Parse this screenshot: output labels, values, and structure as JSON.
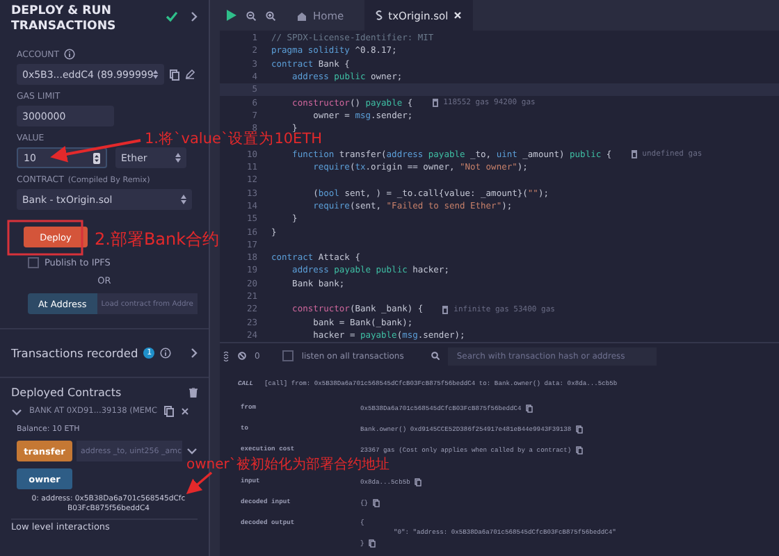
{
  "panel": {
    "title": "DEPLOY & RUN TRANSACTIONS",
    "account": {
      "label": "ACCOUNT",
      "value": "0x5B3...eddC4 (89.999999"
    },
    "gas_limit": {
      "label": "GAS LIMIT",
      "value": "3000000"
    },
    "value": {
      "label": "VALUE",
      "amount": "10",
      "unit": "Ether"
    },
    "contract": {
      "label": "CONTRACT",
      "note": "(Compiled By Remix)",
      "value": "Bank - txOrigin.sol"
    },
    "deploy_button": "Deploy",
    "publish": {
      "label": "Publish to IPFS",
      "checked": false
    },
    "or_label": "OR",
    "at_address_button": "At Address",
    "load_contract_placeholder": "Load contract from Addre",
    "transactions_recorded": {
      "label": "Transactions recorded",
      "count": "1"
    },
    "deployed": {
      "title": "Deployed Contracts",
      "instance": {
        "label": "BANK AT 0XD91...39138 (MEMC",
        "expanded": true,
        "balance": "Balance: 10 ETH",
        "functions": [
          {
            "label": "transfer",
            "kind": "transact",
            "placeholder": "address _to, uint256 _amc"
          },
          {
            "label": "owner",
            "kind": "call"
          }
        ],
        "result": "0: address: 0x5B38Da6a701c568545dCfcB03FcB875f56beddC4"
      },
      "low_level": "Low level interactions"
    }
  },
  "editor": {
    "tabs": [
      {
        "label": "Home",
        "selected": false
      },
      {
        "label": "txOrigin.sol",
        "selected": true
      }
    ],
    "lines": [
      {
        "number": "1",
        "segments": [
          {
            "kind": "comment",
            "text": "// SPDX-License-Identifier: MIT"
          }
        ]
      },
      {
        "number": "2",
        "segments": [
          {
            "kind": "keyword",
            "text": "pragma solidity"
          },
          {
            "kind": "plain",
            "text": " ^0.8.17;"
          }
        ]
      },
      {
        "number": "3",
        "segments": [
          {
            "kind": "keyword",
            "text": "contract"
          },
          {
            "kind": "plain",
            "text": " Bank {"
          }
        ]
      },
      {
        "number": "4",
        "segments": [
          {
            "kind": "keyword",
            "text": "    address"
          },
          {
            "kind": "modifier",
            "text": " public"
          },
          {
            "kind": "plain",
            "text": " owner;"
          }
        ]
      },
      {
        "number": "5",
        "active": true
      },
      {
        "number": "6",
        "segments": [
          {
            "kind": "special",
            "text": "    constructor"
          },
          {
            "kind": "plain",
            "text": "() "
          },
          {
            "kind": "modifier",
            "text": "payable"
          },
          {
            "kind": "plain",
            "text": " {"
          }
        ],
        "hint": "118552 gas 94200 gas"
      },
      {
        "number": "7",
        "segments": [
          {
            "kind": "plain",
            "text": "        owner = "
          },
          {
            "kind": "keyword",
            "text": "msg"
          },
          {
            "kind": "plain",
            "text": ".sender;"
          }
        ]
      },
      {
        "number": "8",
        "segments": [
          {
            "kind": "plain",
            "text": "    }"
          }
        ]
      },
      {
        "active": false
      },
      {
        "number": "10",
        "segments": [
          {
            "kind": "keyword",
            "text": "    function"
          },
          {
            "kind": "plain",
            "text": " transfer("
          },
          {
            "kind": "keyword",
            "text": "address"
          },
          {
            "kind": "modifier",
            "text": " payable"
          },
          {
            "kind": "plain",
            "text": " _to, "
          },
          {
            "kind": "keyword",
            "text": "uint"
          },
          {
            "kind": "plain",
            "text": " _amount) "
          },
          {
            "kind": "modifier",
            "text": "public"
          },
          {
            "kind": "plain",
            "text": " {"
          }
        ],
        "hint": "undefined gas"
      },
      {
        "number": "11",
        "segments": [
          {
            "kind": "keyword",
            "text": "        require"
          },
          {
            "kind": "plain",
            "text": "("
          },
          {
            "kind": "keyword",
            "text": "tx"
          },
          {
            "kind": "plain",
            "text": ".origin == owner, "
          },
          {
            "kind": "string",
            "text": "\"Not owner\""
          },
          {
            "kind": "plain",
            "text": ");"
          }
        ]
      },
      {
        "number": "12",
        "active": false
      },
      {
        "number": "13",
        "segments": [
          {
            "kind": "plain",
            "text": "        ("
          },
          {
            "kind": "keyword",
            "text": "bool"
          },
          {
            "kind": "plain",
            "text": " sent, ) = _to.call{value: _amount}("
          },
          {
            "kind": "string",
            "text": "\"\""
          },
          {
            "kind": "plain",
            "text": ");"
          }
        ]
      },
      {
        "number": "14",
        "segments": [
          {
            "kind": "keyword",
            "text": "        require"
          },
          {
            "kind": "plain",
            "text": "(sent, "
          },
          {
            "kind": "string",
            "text": "\"Failed to send Ether\""
          },
          {
            "kind": "plain",
            "text": ");"
          }
        ]
      },
      {
        "number": "15",
        "segments": [
          {
            "kind": "plain",
            "text": "    }"
          }
        ]
      },
      {
        "number": "16",
        "segments": [
          {
            "kind": "plain",
            "text": "}"
          }
        ]
      },
      {
        "number": "17",
        "active": false
      },
      {
        "number": "18",
        "segments": [
          {
            "kind": "keyword",
            "text": "contract"
          },
          {
            "kind": "plain",
            "text": " Attack {"
          }
        ]
      },
      {
        "number": "19",
        "segments": [
          {
            "kind": "keyword",
            "text": "    address"
          },
          {
            "kind": "modifier",
            "text": " payable public"
          },
          {
            "kind": "plain",
            "text": " hacker;"
          }
        ]
      },
      {
        "number": "20",
        "segments": [
          {
            "kind": "plain",
            "text": "    Bank bank;"
          }
        ]
      },
      {
        "number": "21",
        "active": false
      },
      {
        "number": "22",
        "segments": [
          {
            "kind": "special",
            "text": "    constructor"
          },
          {
            "kind": "plain",
            "text": "(Bank _bank) {"
          }
        ],
        "hint": "infinite gas 53400 gas"
      },
      {
        "number": "23",
        "segments": [
          {
            "kind": "plain",
            "text": "        bank = Bank(_bank);"
          }
        ]
      },
      {
        "number": "24",
        "segments": [
          {
            "kind": "plain",
            "text": "        hacker = "
          },
          {
            "kind": "modifier",
            "text": "payable"
          },
          {
            "kind": "plain",
            "text": "("
          },
          {
            "kind": "keyword",
            "text": "msg"
          },
          {
            "kind": "plain",
            "text": ".sender);"
          }
        ]
      }
    ]
  },
  "terminal": {
    "count": "0",
    "listen": {
      "label": "listen on all transactions",
      "checked": false
    },
    "search_placeholder": "Search with transaction hash or address",
    "log": {
      "tag": "CALL",
      "summary": "[call] from: 0x5B38Da6a701c568545dCfcB03FcB875f56beddC4 to: Bank.owner() data: 0x8da...5cb5b",
      "rows": [
        {
          "key": "from",
          "lines": [
            "0x5B38Da6a701c568545dCfcB03FcB875f56beddC4"
          ]
        },
        {
          "key": "to",
          "lines": [
            "Bank.owner() 0xd9145CCE52D386f254917e481eB44e9943F39138"
          ]
        },
        {
          "key": "execution cost",
          "lines": [
            "23367 gas (Cost only applies when called by a contract)"
          ]
        },
        {
          "key": "input",
          "lines": [
            "0x8da...5cb5b"
          ]
        },
        {
          "key": "decoded input",
          "lines": [
            "{}"
          ]
        },
        {
          "key": "decoded output",
          "lines": [
            "{",
            "\"0\": \"address: 0x5B38Da6a701c568545dCfcB03FcB875f56beddC4\"",
            "}"
          ]
        }
      ]
    }
  },
  "annotations": [
    {
      "text": "1.将`value`设置为10ETH"
    },
    {
      "text": "2.部署Bank合约"
    },
    {
      "text": "owner`被初始化为部署合约地址"
    }
  ]
}
